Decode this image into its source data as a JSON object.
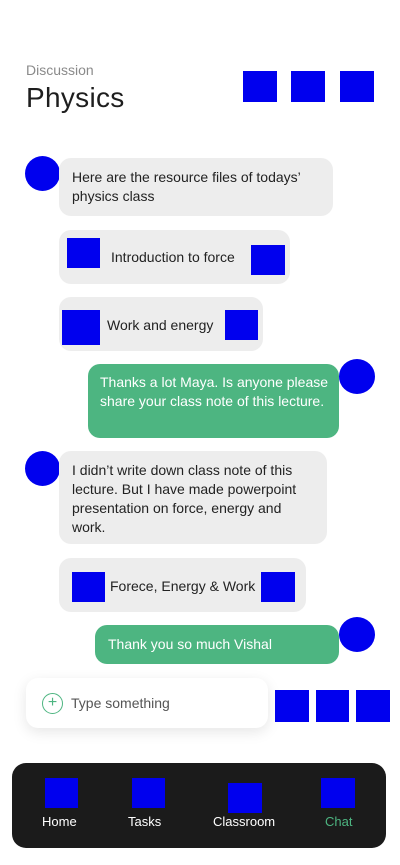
{
  "header": {
    "subtitle": "Discussion",
    "title": "Physics"
  },
  "messages": [
    {
      "type": "text",
      "side": "left",
      "text": "Here are the resource files of todays’ physics class"
    },
    {
      "type": "file",
      "label": "Introduction to force"
    },
    {
      "type": "file",
      "label": "Work and energy"
    },
    {
      "type": "text",
      "side": "right",
      "text": "Thanks a lot Maya. Is anyone please share your class note of this lecture."
    },
    {
      "type": "text",
      "side": "left",
      "text": "I didn’t write down class note of this lecture. But I have made powerpoint presentation on force, energy and work."
    },
    {
      "type": "file",
      "label": "Forece, Energy & Work"
    },
    {
      "type": "text",
      "side": "right",
      "text": "Thank you so much Vishal"
    }
  ],
  "composer": {
    "placeholder": "Type something",
    "add_icon": "plus-icon"
  },
  "nav": {
    "items": [
      {
        "label": "Home",
        "icon": "home-icon"
      },
      {
        "label": "Tasks",
        "icon": "tasks-icon"
      },
      {
        "label": "Classroom",
        "icon": "classroom-icon"
      },
      {
        "label": "Chat",
        "icon": "chat-icon",
        "active": true
      }
    ]
  },
  "colors": {
    "accent": "#4db581",
    "bubble_gray": "#ededed",
    "navbar": "#1b1b1b"
  }
}
